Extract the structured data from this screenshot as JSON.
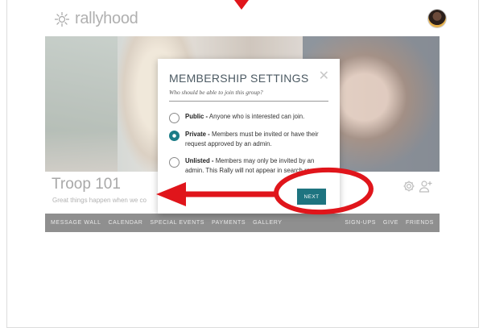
{
  "app": {
    "logo_text": "rallyhood"
  },
  "group": {
    "title": "Troop 101",
    "subtitle": "Great things happen when we co"
  },
  "nav": [
    "MESSAGE WALL",
    "CALENDAR",
    "SPECIAL EVENTS",
    "PAYMENTS",
    "GALLERY",
    "",
    "SIGN-UPS",
    "GIVE",
    "FRIENDS"
  ],
  "modal": {
    "title": "MEMBERSHIP SETTINGS",
    "subtitle": "Who should be able to join this group?",
    "options": [
      {
        "label": "Public -",
        "desc": "Anyone who is interested can join.",
        "selected": false
      },
      {
        "label": "Private -",
        "desc": "Members must be invited or have their request approved by an admin.",
        "selected": true
      },
      {
        "label": "Unlisted -",
        "desc": "Members may only be invited by an admin. This Rally will not appear in search res",
        "selected": false
      }
    ],
    "next_label": "NEXT",
    "close_icon": "close-icon"
  },
  "colors": {
    "accent": "#1e7480",
    "annotation": "#e0151b",
    "nav_bg": "#8f8f8f"
  }
}
